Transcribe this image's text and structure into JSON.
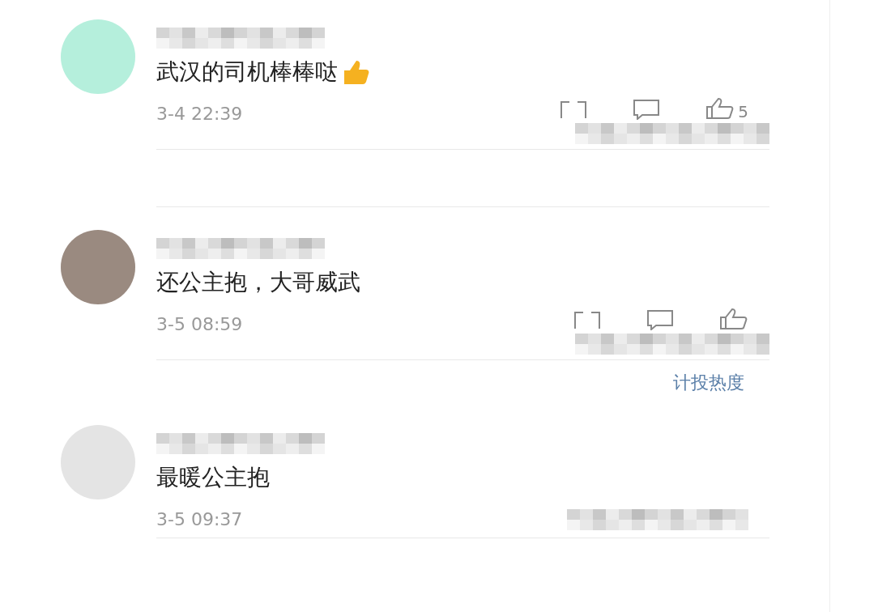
{
  "comments": [
    {
      "kind": "emoji-icons",
      "text": "武汉的司机棒棒哒",
      "time": "3-4 22:39",
      "like_count": "5",
      "color": "#b5efdc"
    },
    {
      "kind": "icons",
      "text": "还公主抱，大哥威武",
      "time": "3-5 08:59",
      "color": "#9a8a80",
      "note": "计投热度"
    },
    {
      "kind": "mosaic",
      "text": "最暖公主抱",
      "time": "3-5 09:37",
      "color": "#e4e4e4"
    }
  ]
}
